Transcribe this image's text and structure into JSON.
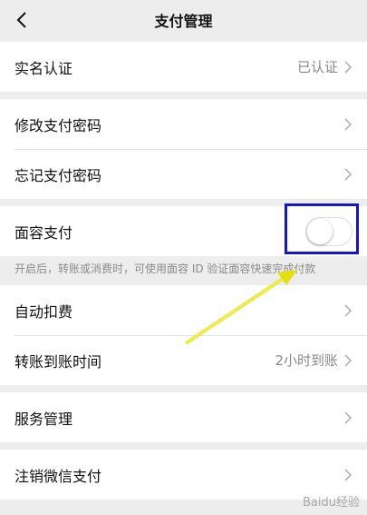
{
  "header": {
    "title": "支付管理",
    "back_icon": "chevron-left-icon"
  },
  "group1": {
    "items": [
      {
        "label": "实名认证",
        "value": "已认证"
      }
    ]
  },
  "group2": {
    "items": [
      {
        "label": "修改支付密码"
      },
      {
        "label": "忘记支付密码"
      }
    ]
  },
  "face_pay": {
    "label": "面容支付",
    "enabled": false,
    "note": "开启后，转账或消费时，可使用面容 ID 验证面容快速完成付款"
  },
  "group3": {
    "items": [
      {
        "label": "自动扣费"
      },
      {
        "label": "转账到账时间",
        "value": "2小时到账"
      }
    ]
  },
  "group4": {
    "items": [
      {
        "label": "服务管理"
      }
    ]
  },
  "group5": {
    "items": [
      {
        "label": "注销微信支付"
      }
    ]
  },
  "annotation": {
    "box_color": "#1616c8",
    "arrow_color": "#f2f20a"
  },
  "watermark": "Baidu经验"
}
